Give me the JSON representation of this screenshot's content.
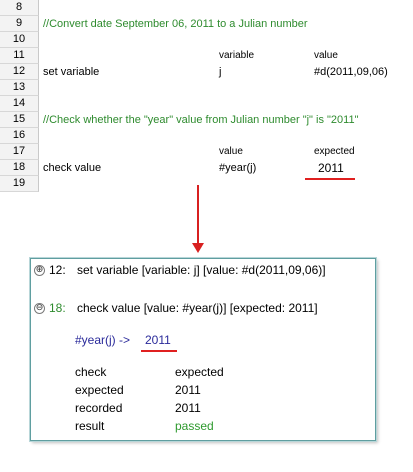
{
  "sheet": {
    "rows": [
      {
        "num": "8"
      },
      {
        "num": "9",
        "a": "//Convert date September 06, 2011 to a Julian number"
      },
      {
        "num": "10"
      },
      {
        "num": "11",
        "c": "variable",
        "d": "value"
      },
      {
        "num": "12",
        "a": "set variable",
        "c": "j",
        "d": "#d(2011,09,06)"
      },
      {
        "num": "13"
      },
      {
        "num": "14"
      },
      {
        "num": "15",
        "a": "//Check whether the \"year\" value from Julian number \"j\" is \"2011\""
      },
      {
        "num": "16"
      },
      {
        "num": "17",
        "c": "value",
        "d": "expected"
      },
      {
        "num": "18",
        "a": "check value",
        "c": "#year(j)",
        "d": "2011"
      },
      {
        "num": "19"
      }
    ],
    "colors": {
      "comment": "#2e8b2e",
      "underline": "#e02020"
    }
  },
  "panel": {
    "line1": {
      "expander": "⊕",
      "num": "12:",
      "text": "set variable    [variable: j] [value: #d(2011,09,06)]"
    },
    "line2": {
      "expander": "⊖",
      "num": "18:",
      "text": "check value    [value: #year(j)] [expected: 2011]"
    },
    "expr": {
      "left": "#year(j) ->",
      "right": "2011"
    },
    "table": [
      {
        "key": "check",
        "value": "expected"
      },
      {
        "key": "expected",
        "value": "2011"
      },
      {
        "key": "recorded",
        "value": "2011"
      },
      {
        "key": "result",
        "value": "passed"
      }
    ],
    "colors": {
      "border": "#5f9ea0",
      "passed": "#2e9a2e",
      "expr": "#2a2a9a"
    }
  }
}
